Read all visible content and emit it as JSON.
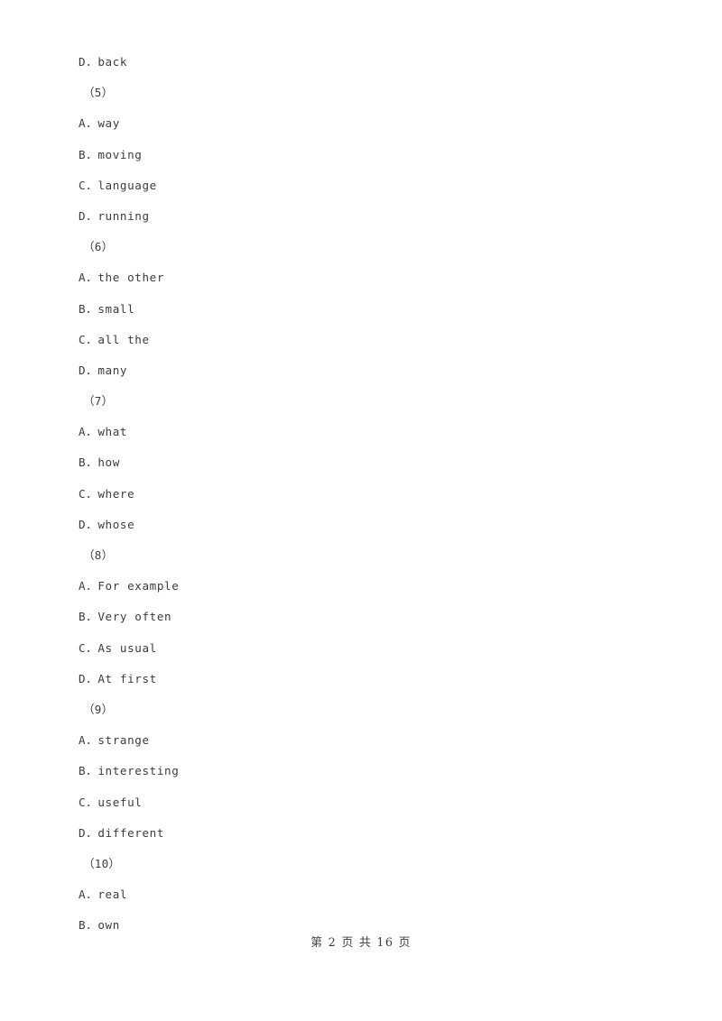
{
  "document": {
    "page_background": "#ffffff",
    "text_color": "#3c3c3c",
    "lines": [
      {
        "kind": "option",
        "text": "D．back"
      },
      {
        "kind": "qnum",
        "text": "（5）"
      },
      {
        "kind": "option",
        "text": "A．way"
      },
      {
        "kind": "option",
        "text": "B．moving"
      },
      {
        "kind": "option",
        "text": "C．language"
      },
      {
        "kind": "option",
        "text": "D．running"
      },
      {
        "kind": "qnum",
        "text": "（6）"
      },
      {
        "kind": "option",
        "text": "A．the other"
      },
      {
        "kind": "option",
        "text": "B．small"
      },
      {
        "kind": "option",
        "text": "C．all the"
      },
      {
        "kind": "option",
        "text": "D．many"
      },
      {
        "kind": "qnum",
        "text": "（7）"
      },
      {
        "kind": "option",
        "text": "A．what"
      },
      {
        "kind": "option",
        "text": "B．how"
      },
      {
        "kind": "option",
        "text": "C．where"
      },
      {
        "kind": "option",
        "text": "D．whose"
      },
      {
        "kind": "qnum",
        "text": "（8）"
      },
      {
        "kind": "option",
        "text": "A．For example"
      },
      {
        "kind": "option",
        "text": "B．Very often"
      },
      {
        "kind": "option",
        "text": "C．As usual"
      },
      {
        "kind": "option",
        "text": "D．At first"
      },
      {
        "kind": "qnum",
        "text": "（9）"
      },
      {
        "kind": "option",
        "text": "A．strange"
      },
      {
        "kind": "option",
        "text": "B．interesting"
      },
      {
        "kind": "option",
        "text": "C．useful"
      },
      {
        "kind": "option",
        "text": "D．different"
      },
      {
        "kind": "qnum",
        "text": "（10）"
      },
      {
        "kind": "option",
        "text": "A．real"
      },
      {
        "kind": "option",
        "text": "B．own"
      }
    ],
    "footer": {
      "text": "第 2 页 共 16 页",
      "current_page": "2",
      "total_pages": "16"
    }
  }
}
